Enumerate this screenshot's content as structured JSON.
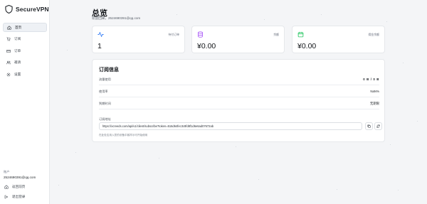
{
  "sidebar": {
    "brand": "SecureVPN",
    "items": [
      {
        "label": "首页",
        "icon": "home-icon",
        "active": true
      },
      {
        "label": "订阅",
        "icon": "cart-icon",
        "active": false
      },
      {
        "label": "订单",
        "icon": "card-icon",
        "active": false
      },
      {
        "label": "邀请",
        "icon": "users-icon",
        "active": false
      },
      {
        "label": "设置",
        "icon": "gear-icon",
        "active": false
      }
    ],
    "account_label": "账户",
    "account_email": "2524690391@qq.com",
    "bottom": [
      {
        "label": "返回前页",
        "icon": "home-icon"
      },
      {
        "label": "退出登录",
        "icon": "logout-icon"
      }
    ]
  },
  "header": {
    "title": "总览",
    "welcome": "欢迎回来，2524690391@qq.com"
  },
  "stats": [
    {
      "label": "待付订单",
      "value": "1",
      "icon": "activity-icon",
      "color": "#3b82f6"
    },
    {
      "label": "余额",
      "value": "¥0.00",
      "icon": "database-icon",
      "color": "#a855f7"
    },
    {
      "label": "佣金余额",
      "value": "¥0.00",
      "icon": "calendar-icon",
      "color": "#22c55e"
    }
  ],
  "subscription": {
    "title": "订阅信息",
    "rows": [
      {
        "key": "流量使用",
        "value": "0 B / 0 B"
      },
      {
        "key": "使用率",
        "value": "NaN%"
      },
      {
        "key": "到期时间",
        "value": "无期限"
      }
    ],
    "url_label": "订阅地址",
    "url": "https://xcreeds.com/api/v1/client/subscribe?token=516d64fec3c8fd8f1d6e6ad07672ab",
    "hint": "在此处应用入您的设备中客样示可开始使用"
  }
}
